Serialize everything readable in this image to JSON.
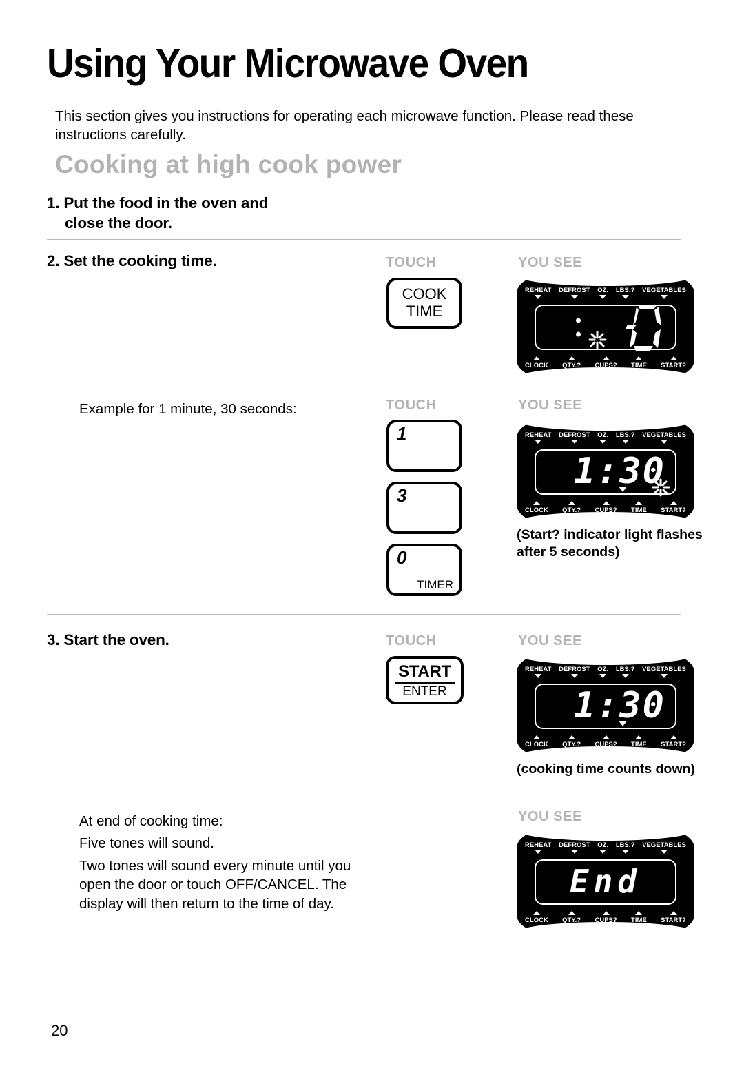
{
  "document": {
    "title": "Using Your Microwave Oven",
    "intro": "This section gives you instructions for operating each microwave function. Please read these instructions carefully.",
    "section_title": "Cooking at high cook power",
    "page_number": "20"
  },
  "column_headers": {
    "touch": "TOUCH",
    "you_see": "YOU SEE"
  },
  "steps": {
    "step1": {
      "line1": "1. Put the food in the oven and",
      "line2": "close the door."
    },
    "step2": {
      "heading": "2. Set the cooking time.",
      "example_label": "Example for 1 minute, 30 seconds:"
    },
    "step3": {
      "heading": "3. Start the oven."
    }
  },
  "buttons": {
    "cook_time": {
      "line1": "COOK",
      "line2": "TIME"
    },
    "one": {
      "digit": "1",
      "sub": ""
    },
    "three": {
      "digit": "3",
      "sub": ""
    },
    "zero": {
      "digit": "0",
      "sub": "TIMER"
    },
    "start": {
      "primary": "START",
      "secondary": "ENTER"
    }
  },
  "display_panel": {
    "top_indicators": [
      "REHEAT",
      "DEFROST",
      "OZ.",
      "LBS.?",
      "VEGETABLES"
    ],
    "bottom_indicators": [
      "CLOCK",
      "QTY.?",
      "CUPS?",
      "TIME",
      "START?"
    ]
  },
  "displays": {
    "d1": {
      "value": "",
      "note": "flashing 0 with colon"
    },
    "d2": {
      "value": "1:30"
    },
    "d3": {
      "value": "1:30"
    },
    "d4": {
      "value": "End"
    }
  },
  "captions": {
    "start_flash": "(Start? indicator light flashes after 5 seconds)",
    "counts_down": "(cooking time counts down)"
  },
  "end_text": {
    "line1": "At end of cooking time:",
    "line2": "Five tones will sound.",
    "para": "Two tones will sound every minute until you open the door or touch OFF/CANCEL. The display will then return to the time of day."
  },
  "colors": {
    "gray_label": "#b3b3b3",
    "rule": "#b9b9b9",
    "display_bg": "#000000"
  }
}
